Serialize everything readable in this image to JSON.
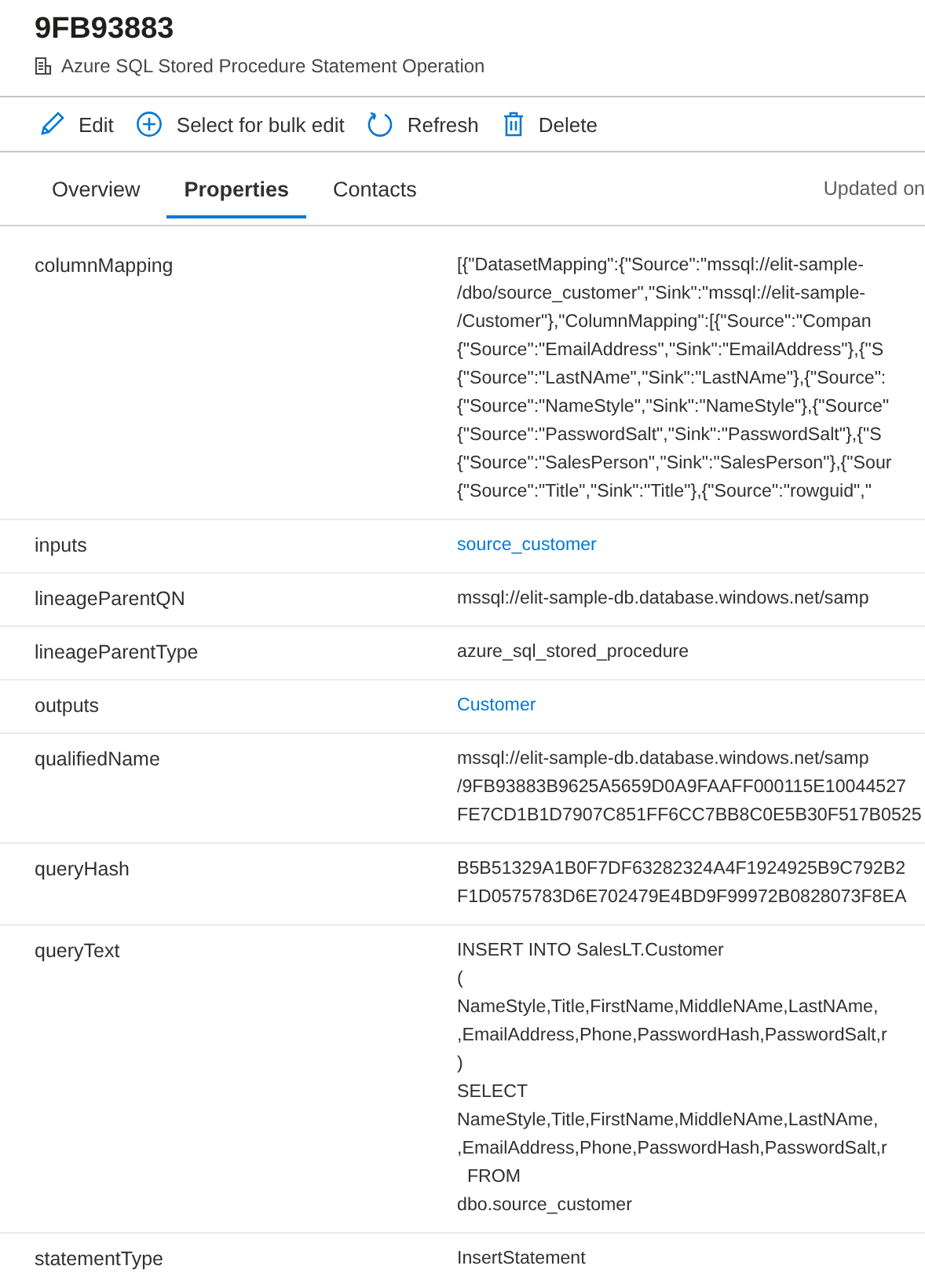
{
  "header": {
    "title": "9FB93883",
    "subtitle": "Azure SQL Stored Procedure Statement Operation"
  },
  "toolbar": [
    {
      "kind": "edit",
      "label": "Edit"
    },
    {
      "kind": "add",
      "label": "Select for bulk edit"
    },
    {
      "kind": "refresh",
      "label": "Refresh"
    },
    {
      "kind": "delete",
      "label": "Delete"
    }
  ],
  "tabs": [
    {
      "label": "Overview",
      "selected": false
    },
    {
      "label": "Properties",
      "selected": true
    },
    {
      "label": "Contacts",
      "selected": false
    }
  ],
  "updated": "Updated on",
  "properties": [
    {
      "name": "columnMapping",
      "kind": "text",
      "lines": [
        "[{\"DatasetMapping\":{\"Source\":\"mssql://elit-sample-",
        "/dbo/source_customer\",\"Sink\":\"mssql://elit-sample-",
        "/Customer\"},\"ColumnMapping\":[{\"Source\":\"Compan",
        "{\"Source\":\"EmailAddress\",\"Sink\":\"EmailAddress\"},{\"S",
        "{\"Source\":\"LastNAme\",\"Sink\":\"LastNAme\"},{\"Source\":",
        "{\"Source\":\"NameStyle\",\"Sink\":\"NameStyle\"},{\"Source\"",
        "{\"Source\":\"PasswordSalt\",\"Sink\":\"PasswordSalt\"},{\"S",
        "{\"Source\":\"SalesPerson\",\"Sink\":\"SalesPerson\"},{\"Sour",
        "{\"Source\":\"Title\",\"Sink\":\"Title\"},{\"Source\":\"rowguid\",\""
      ]
    },
    {
      "name": "inputs",
      "kind": "link",
      "lines": [
        "source_customer"
      ]
    },
    {
      "name": "lineageParentQN",
      "kind": "text",
      "lines": [
        "mssql://elit-sample-db.database.windows.net/samp"
      ]
    },
    {
      "name": "lineageParentType",
      "kind": "text",
      "lines": [
        "azure_sql_stored_procedure"
      ]
    },
    {
      "name": "outputs",
      "kind": "link",
      "lines": [
        "Customer"
      ]
    },
    {
      "name": "qualifiedName",
      "kind": "text",
      "lines": [
        "mssql://elit-sample-db.database.windows.net/samp",
        "/9FB93883B9625A5659D0A9FAAFF000115E10044527",
        "FE7CD1B1D7907C851FF6CC7BB8C0E5B30F517B0525"
      ]
    },
    {
      "name": "queryHash",
      "kind": "text",
      "lines": [
        "B5B51329A1B0F7DF63282324A4F1924925B9C792B2",
        "F1D0575783D6E702479E4BD9F99972B0828073F8EA"
      ]
    },
    {
      "name": "queryText",
      "kind": "text",
      "lines": [
        "INSERT INTO SalesLT.Customer",
        "(",
        "NameStyle,Title,FirstName,MiddleNAme,LastNAme,",
        ",EmailAddress,Phone,PasswordHash,PasswordSalt,r",
        ")",
        "SELECT",
        "NameStyle,Title,FirstName,MiddleNAme,LastNAme,",
        ",EmailAddress,Phone,PasswordHash,PasswordSalt,r",
        "  FROM",
        "dbo.source_customer"
      ]
    },
    {
      "name": "statementType",
      "kind": "text",
      "lines": [
        "InsertStatement"
      ]
    }
  ]
}
